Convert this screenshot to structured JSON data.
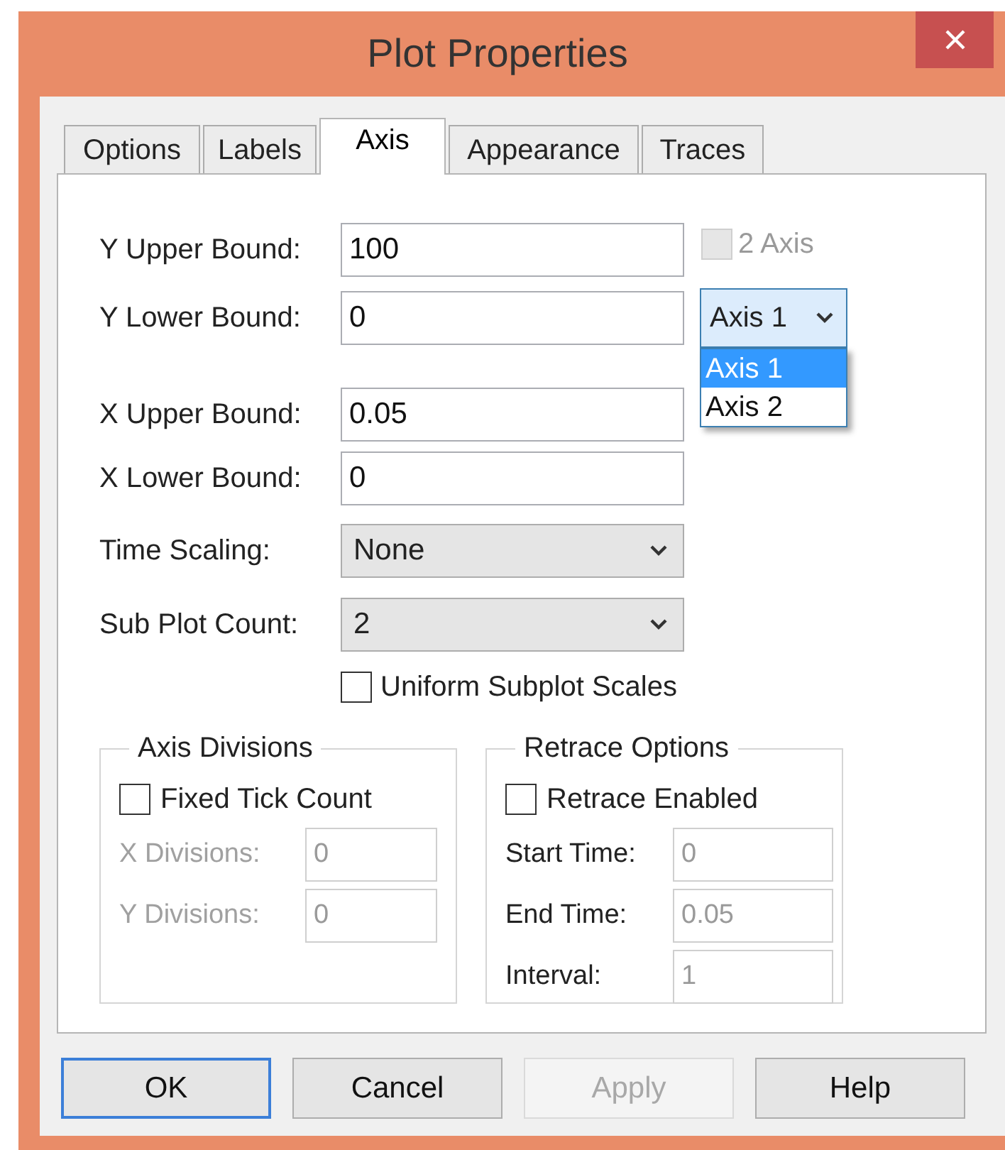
{
  "window": {
    "title": "Plot Properties"
  },
  "tabs": [
    {
      "label": "Options",
      "selected": false
    },
    {
      "label": "Labels",
      "selected": false
    },
    {
      "label": "Axis",
      "selected": true
    },
    {
      "label": "Appearance",
      "selected": false
    },
    {
      "label": "Traces",
      "selected": false
    }
  ],
  "fields": [
    {
      "kind": "text",
      "label": "Y Upper Bound:",
      "value": "100"
    },
    {
      "kind": "text",
      "label": "Y Lower Bound:",
      "value": "0"
    },
    {
      "kind": "text",
      "label": "X Upper Bound:",
      "value": "0.05"
    },
    {
      "kind": "text",
      "label": "X Lower Bound:",
      "value": "0"
    },
    {
      "kind": "select",
      "label": "Time Scaling:",
      "value": "None"
    },
    {
      "kind": "select",
      "label": "Sub Plot Count:",
      "value": "2"
    }
  ],
  "two_axis": {
    "label": "2 Axis",
    "checked": false,
    "disabled": true
  },
  "axis_select": {
    "value": "Axis 1",
    "expanded": true,
    "options": [
      {
        "label": "Axis 1",
        "selected": true
      },
      {
        "label": "Axis 2",
        "selected": false
      }
    ]
  },
  "uniform_scales": {
    "label": "Uniform Subplot Scales",
    "checked": false
  },
  "groups": [
    {
      "title": "Axis Divisions",
      "labels_dimmed": true,
      "checkbox": {
        "label": "Fixed Tick Count",
        "checked": false
      },
      "fields": [
        {
          "label": "X Divisions:",
          "value": "0",
          "disabled": true
        },
        {
          "label": "Y Divisions:",
          "value": "0",
          "disabled": true
        }
      ]
    },
    {
      "title": "Retrace Options",
      "labels_dimmed": false,
      "checkbox": {
        "label": "Retrace Enabled",
        "checked": false
      },
      "fields": [
        {
          "label": "Start Time:",
          "value": "0",
          "disabled": true
        },
        {
          "label": "End Time:",
          "value": "0.05",
          "disabled": true
        },
        {
          "label": "Interval:",
          "value": "1",
          "disabled": true
        }
      ]
    }
  ],
  "buttons": [
    {
      "label": "OK",
      "default": true,
      "disabled": false
    },
    {
      "label": "Cancel",
      "default": false,
      "disabled": false
    },
    {
      "label": "Apply",
      "default": false,
      "disabled": true
    },
    {
      "label": "Help",
      "default": false,
      "disabled": false
    }
  ]
}
